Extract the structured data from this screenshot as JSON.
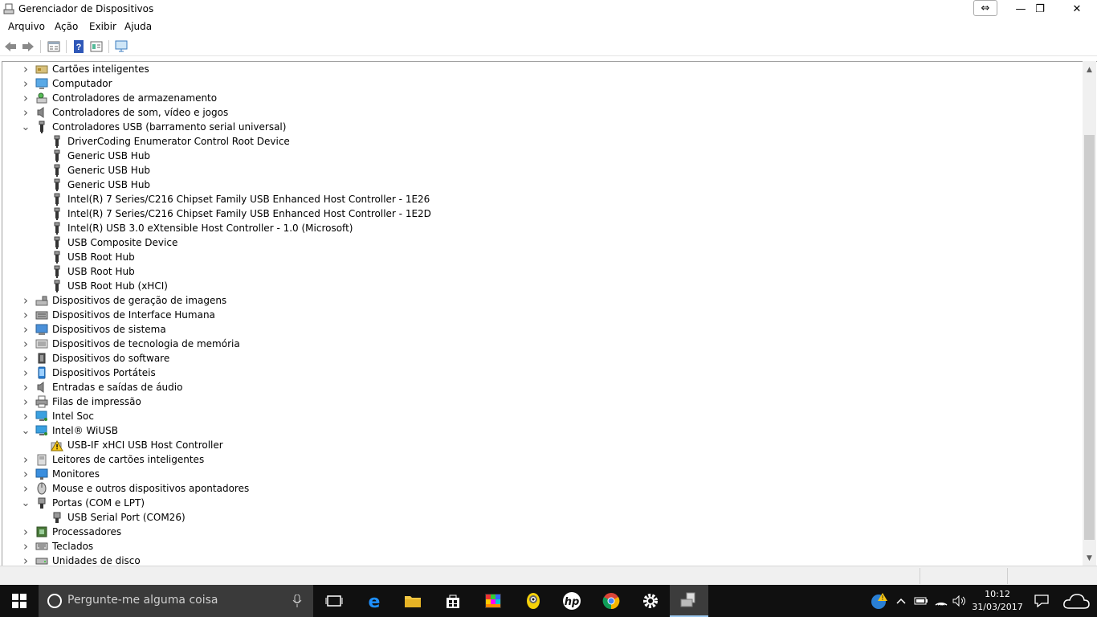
{
  "window": {
    "title": "Gerenciador de Dispositivos",
    "snap_icon": "⇔",
    "minimize_icon": "—",
    "restore_icon": "❐",
    "close_icon": "✕"
  },
  "menu": [
    "Arquivo",
    "Ação",
    "Exibir",
    "Ajuda"
  ],
  "toolbar": [
    "back-icon",
    "forward-icon",
    "properties-icon",
    "help-icon",
    "update-driver-icon",
    "scan-hardware-icon"
  ],
  "tree": [
    {
      "label": "Cartões inteligentes",
      "level": 0,
      "expanded": false,
      "icon": "smartcard-icon"
    },
    {
      "label": "Computador",
      "level": 0,
      "expanded": false,
      "icon": "computer-icon"
    },
    {
      "label": "Controladores de armazenamento",
      "level": 0,
      "expanded": false,
      "icon": "storage-controller-icon"
    },
    {
      "label": "Controladores de som, vídeo e jogos",
      "level": 0,
      "expanded": false,
      "icon": "speaker-icon"
    },
    {
      "label": "Controladores USB (barramento serial universal)",
      "level": 0,
      "expanded": true,
      "icon": "usb-icon"
    },
    {
      "label": "DriverCoding Enumerator Control Root Device",
      "level": 1,
      "icon": "usb-icon"
    },
    {
      "label": "Generic USB Hub",
      "level": 1,
      "icon": "usb-icon"
    },
    {
      "label": "Generic USB Hub",
      "level": 1,
      "icon": "usb-icon"
    },
    {
      "label": "Generic USB Hub",
      "level": 1,
      "icon": "usb-icon"
    },
    {
      "label": "Intel(R) 7 Series/C216 Chipset Family USB Enhanced Host Controller - 1E26",
      "level": 1,
      "icon": "usb-icon"
    },
    {
      "label": "Intel(R) 7 Series/C216 Chipset Family USB Enhanced Host Controller - 1E2D",
      "level": 1,
      "icon": "usb-icon"
    },
    {
      "label": "Intel(R) USB 3.0 eXtensible Host Controller - 1.0 (Microsoft)",
      "level": 1,
      "icon": "usb-icon"
    },
    {
      "label": "USB Composite Device",
      "level": 1,
      "icon": "usb-icon"
    },
    {
      "label": "USB Root Hub",
      "level": 1,
      "icon": "usb-icon"
    },
    {
      "label": "USB Root Hub",
      "level": 1,
      "icon": "usb-icon"
    },
    {
      "label": "USB Root Hub (xHCI)",
      "level": 1,
      "icon": "usb-icon"
    },
    {
      "label": "Dispositivos de geração de imagens",
      "level": 0,
      "expanded": false,
      "icon": "camera-icon"
    },
    {
      "label": "Dispositivos de Interface Humana",
      "level": 0,
      "expanded": false,
      "icon": "hid-icon"
    },
    {
      "label": "Dispositivos de sistema",
      "level": 0,
      "expanded": false,
      "icon": "system-device-icon"
    },
    {
      "label": "Dispositivos de tecnologia de memória",
      "level": 0,
      "expanded": false,
      "icon": "memory-icon"
    },
    {
      "label": "Dispositivos do software",
      "level": 0,
      "expanded": false,
      "icon": "software-device-icon"
    },
    {
      "label": "Dispositivos Portáteis",
      "level": 0,
      "expanded": false,
      "icon": "portable-device-icon"
    },
    {
      "label": "Entradas e saídas de áudio",
      "level": 0,
      "expanded": false,
      "icon": "audio-icon"
    },
    {
      "label": "Filas de impressão",
      "level": 0,
      "expanded": false,
      "icon": "printer-icon"
    },
    {
      "label": "Intel Soc",
      "level": 0,
      "expanded": false,
      "icon": "network-monitor-icon"
    },
    {
      "label": "Intel® WiUSB",
      "level": 0,
      "expanded": true,
      "icon": "network-monitor-icon"
    },
    {
      "label": "USB-IF xHCI USB Host Controller",
      "level": 1,
      "icon": "warning-icon"
    },
    {
      "label": "Leitores de cartões inteligentes",
      "level": 0,
      "expanded": false,
      "icon": "card-reader-icon"
    },
    {
      "label": "Monitores",
      "level": 0,
      "expanded": false,
      "icon": "monitor-icon"
    },
    {
      "label": "Mouse e outros dispositivos apontadores",
      "level": 0,
      "expanded": false,
      "icon": "mouse-icon"
    },
    {
      "label": "Portas (COM e LPT)",
      "level": 0,
      "expanded": true,
      "icon": "port-icon"
    },
    {
      "label": "USB Serial Port (COM26)",
      "level": 1,
      "icon": "port-icon"
    },
    {
      "label": "Processadores",
      "level": 0,
      "expanded": false,
      "icon": "processor-icon"
    },
    {
      "label": "Teclados",
      "level": 0,
      "expanded": false,
      "icon": "keyboard-icon"
    },
    {
      "label": "Unidades de disco",
      "level": 0,
      "expanded": false,
      "icon": "disk-icon"
    }
  ],
  "taskbar": {
    "search_placeholder": "Pergunte-me alguma coisa",
    "apps": [
      "task-view-icon",
      "edge-icon",
      "file-explorer-icon",
      "store-icon",
      "photos-app-icon",
      "minion-app-icon",
      "hp-icon",
      "chrome-icon",
      "settings-icon",
      "device-manager-taskbar-icon"
    ],
    "clock_time": "10:12",
    "clock_date": "31/03/2017"
  },
  "colors": {
    "taskbar": "#101010",
    "search": "#3a3a3a",
    "accent": "#0078d7"
  }
}
